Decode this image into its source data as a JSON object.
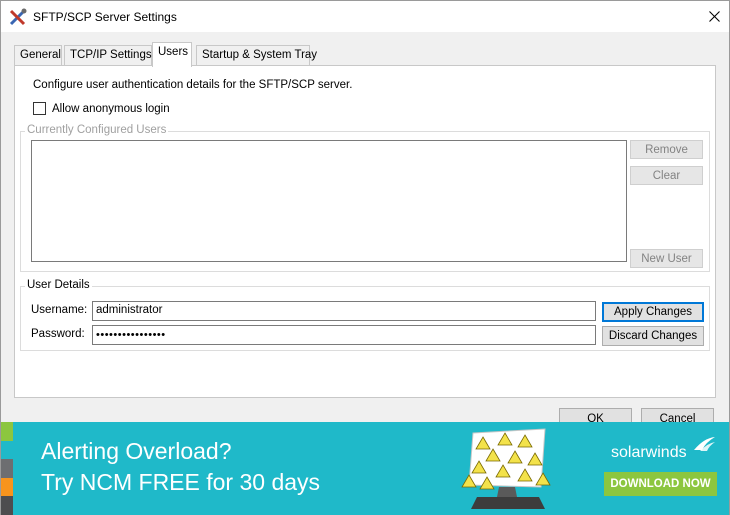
{
  "window": {
    "title": "SFTP/SCP Server Settings",
    "app_icon": "tools-icon",
    "close_icon": "close-icon"
  },
  "tabs": [
    {
      "label": "General",
      "active": false
    },
    {
      "label": "TCP/IP Settings",
      "active": false
    },
    {
      "label": "Users",
      "active": true
    },
    {
      "label": "Startup & System Tray",
      "active": false
    }
  ],
  "users_tab": {
    "intro": "Configure user authentication details for the SFTP/SCP server.",
    "allow_anonymous": {
      "label": "Allow anonymous login",
      "checked": false
    },
    "configured_users": {
      "legend": "Currently Configured Users",
      "items": [],
      "buttons": {
        "remove": "Remove",
        "clear": "Clear",
        "new_user": "New User"
      }
    },
    "user_details": {
      "legend": "User Details",
      "username_label": "Username:",
      "username_value": "administrator",
      "password_label": "Password:",
      "password_value": "••••••••••••••••",
      "apply": "Apply Changes",
      "discard": "Discard Changes"
    }
  },
  "footer": {
    "ok": "OK",
    "cancel": "Cancel"
  },
  "banner": {
    "line1": "Alerting Overload?",
    "line2": "Try NCM FREE for 30 days",
    "brand": "solarwinds",
    "cta": "DOWNLOAD NOW",
    "art_icon": "warning-monitor-icon",
    "brand_icon": "solarwinds-flare-icon",
    "colors": {
      "background": "#1fb9c9",
      "cta": "#8cc63f",
      "warning": "#f3e24a"
    }
  }
}
